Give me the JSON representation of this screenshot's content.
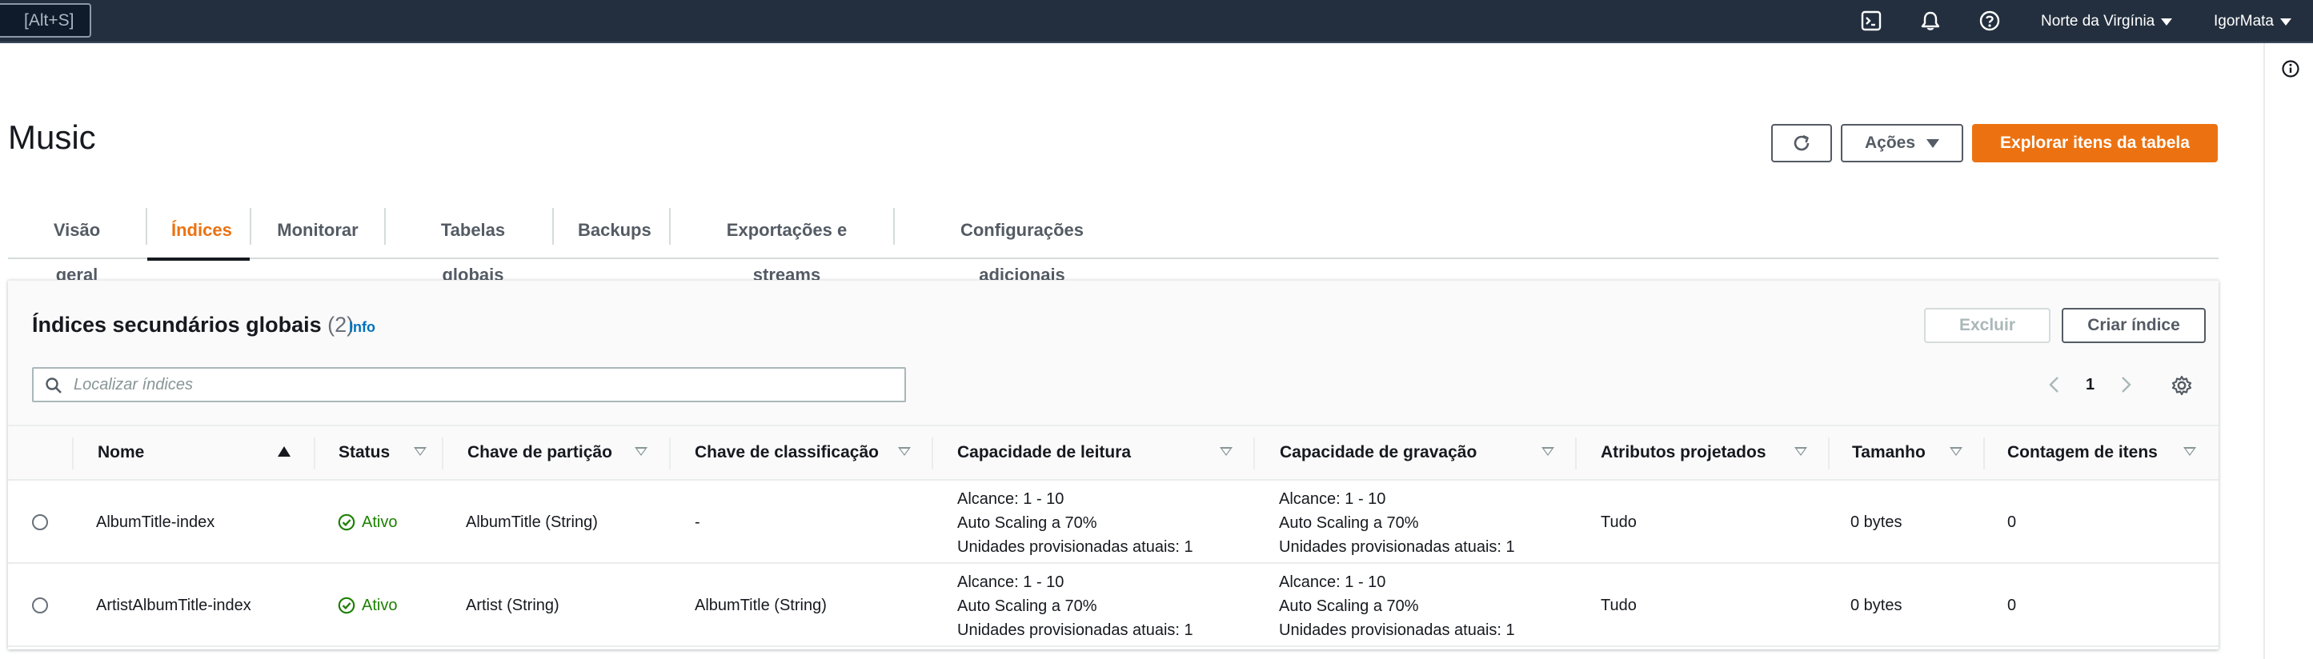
{
  "topnav": {
    "shortcut": "[Alt+S]",
    "icons": [
      "cloudshell-icon",
      "notifications-icon",
      "help-icon"
    ],
    "region": "Norte da Virgínia",
    "user": "IgorMata"
  },
  "page": {
    "title": "Music",
    "actions": {
      "refresh_icon": "refresh-icon",
      "acoes": "Ações",
      "explore": "Explorar itens da tabela"
    }
  },
  "tabs": [
    {
      "label": "Visão geral",
      "active": false
    },
    {
      "label": "Índices",
      "active": true
    },
    {
      "label": "Monitorar",
      "active": false
    },
    {
      "label": "Tabelas globais",
      "active": false
    },
    {
      "label": "Backups",
      "active": false
    },
    {
      "label": "Exportações e streams",
      "active": false
    },
    {
      "label": "Configurações adicionais",
      "active": false
    }
  ],
  "gsi": {
    "title": "Índices secundários globais",
    "count": "(2)",
    "info": "Info",
    "delete": "Excluir",
    "create": "Criar índice",
    "search_placeholder": "Localizar índices",
    "page": "1",
    "columns": [
      "Nome",
      "Status",
      "Chave de partição",
      "Chave de classificação",
      "Capacidade de leitura",
      "Capacidade de gravação",
      "Atributos projetados",
      "Tamanho",
      "Contagem de itens"
    ],
    "rows": [
      {
        "name": "AlbumTitle-index",
        "status": "Ativo",
        "partition_key": "AlbumTitle (String)",
        "sort_key": "-",
        "read": [
          "Alcance: 1 - 10",
          "Auto Scaling a 70%",
          "Unidades provisionadas atuais: 1"
        ],
        "write": [
          "Alcance: 1 - 10",
          "Auto Scaling a 70%",
          "Unidades provisionadas atuais: 1"
        ],
        "projected": "Tudo",
        "size": "0 bytes",
        "item_count": "0"
      },
      {
        "name": "ArtistAlbumTitle-index",
        "status": "Ativo",
        "partition_key": "Artist (String)",
        "sort_key": "AlbumTitle (String)",
        "read": [
          "Alcance: 1 - 10",
          "Auto Scaling a 70%",
          "Unidades provisionadas atuais: 1"
        ],
        "write": [
          "Alcance: 1 - 10",
          "Auto Scaling a 70%",
          "Unidades provisionadas atuais: 1"
        ],
        "projected": "Tudo",
        "size": "0 bytes",
        "item_count": "0"
      }
    ]
  },
  "colors": {
    "nav_bg": "#232f3e",
    "accent": "#ec7211",
    "link": "#0073bb",
    "success": "#1d8102"
  }
}
